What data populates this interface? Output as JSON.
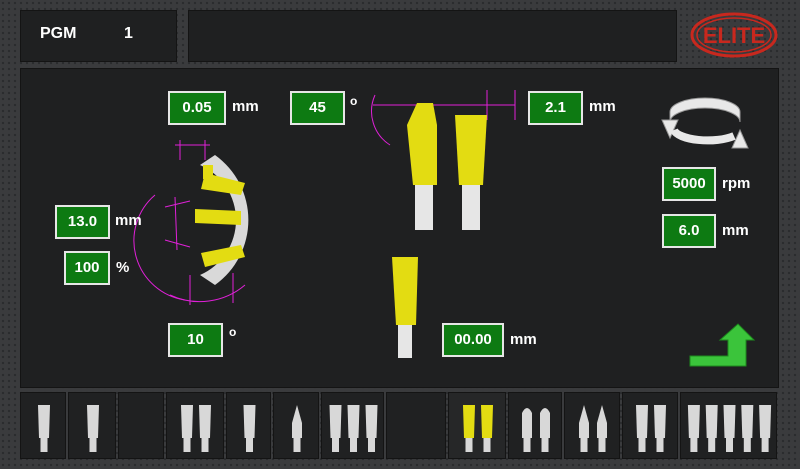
{
  "header": {
    "pgm_label": "PGM",
    "pgm_number": "1",
    "logo_text": "ELITE"
  },
  "left": {
    "offset_value": "0.05",
    "offset_unit": "mm",
    "depth_value": "13.0",
    "depth_unit": "mm",
    "percent_value": "100",
    "percent_unit": "%",
    "angle_value": "10",
    "angle_unit": "o"
  },
  "center": {
    "angle_value": "45",
    "angle_unit": "o",
    "width_value": "2.1",
    "width_unit": "mm",
    "bottom_value": "00.00",
    "bottom_unit": "mm"
  },
  "right": {
    "rpm_value": "5000",
    "rpm_unit": "rpm",
    "feed_value": "6.0",
    "feed_unit": "mm"
  },
  "toolbar": {
    "selected_index": 9,
    "slots": 14
  },
  "colors": {
    "field_green": "#0d7a12",
    "tool_yellow": "#e3dc12",
    "dimension_magenta": "#e020d8",
    "logo_red": "#c8281e",
    "arrow_green": "#3bc43b"
  },
  "icons": {
    "rotate": "rotate-icon",
    "next": "next-arrow-icon",
    "logo": "elite-logo"
  }
}
